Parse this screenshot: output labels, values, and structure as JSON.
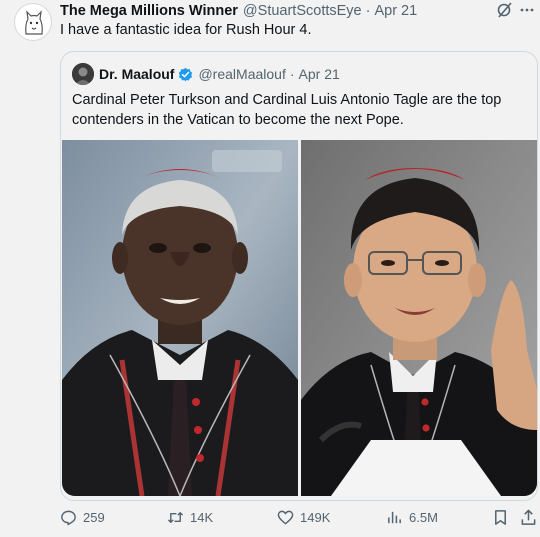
{
  "tweet": {
    "author_name": "The Mega Millions Winner",
    "author_handle": "@StuartScottsEye",
    "separator": "·",
    "date": "Apr 21",
    "text": "I have a fantastic idea for Rush Hour 4."
  },
  "quoted_tweet": {
    "author_name": "Dr. Maalouf",
    "author_handle": "@realMaalouf",
    "separator": "·",
    "date": "Apr 21",
    "text": "Cardinal Peter Turkson and Cardinal Luis Antonio Tagle are the top contenders in the Vatican to become the next Pope.",
    "verified_color": "#1d9bf0"
  },
  "actions": {
    "replies": "259",
    "reposts": "14K",
    "likes": "149K",
    "views": "6.5M"
  },
  "icons": [
    "grok-icon",
    "more-icon",
    "verified-icon",
    "reply-icon",
    "repost-icon",
    "like-icon",
    "views-icon",
    "bookmark-icon",
    "share-icon"
  ]
}
